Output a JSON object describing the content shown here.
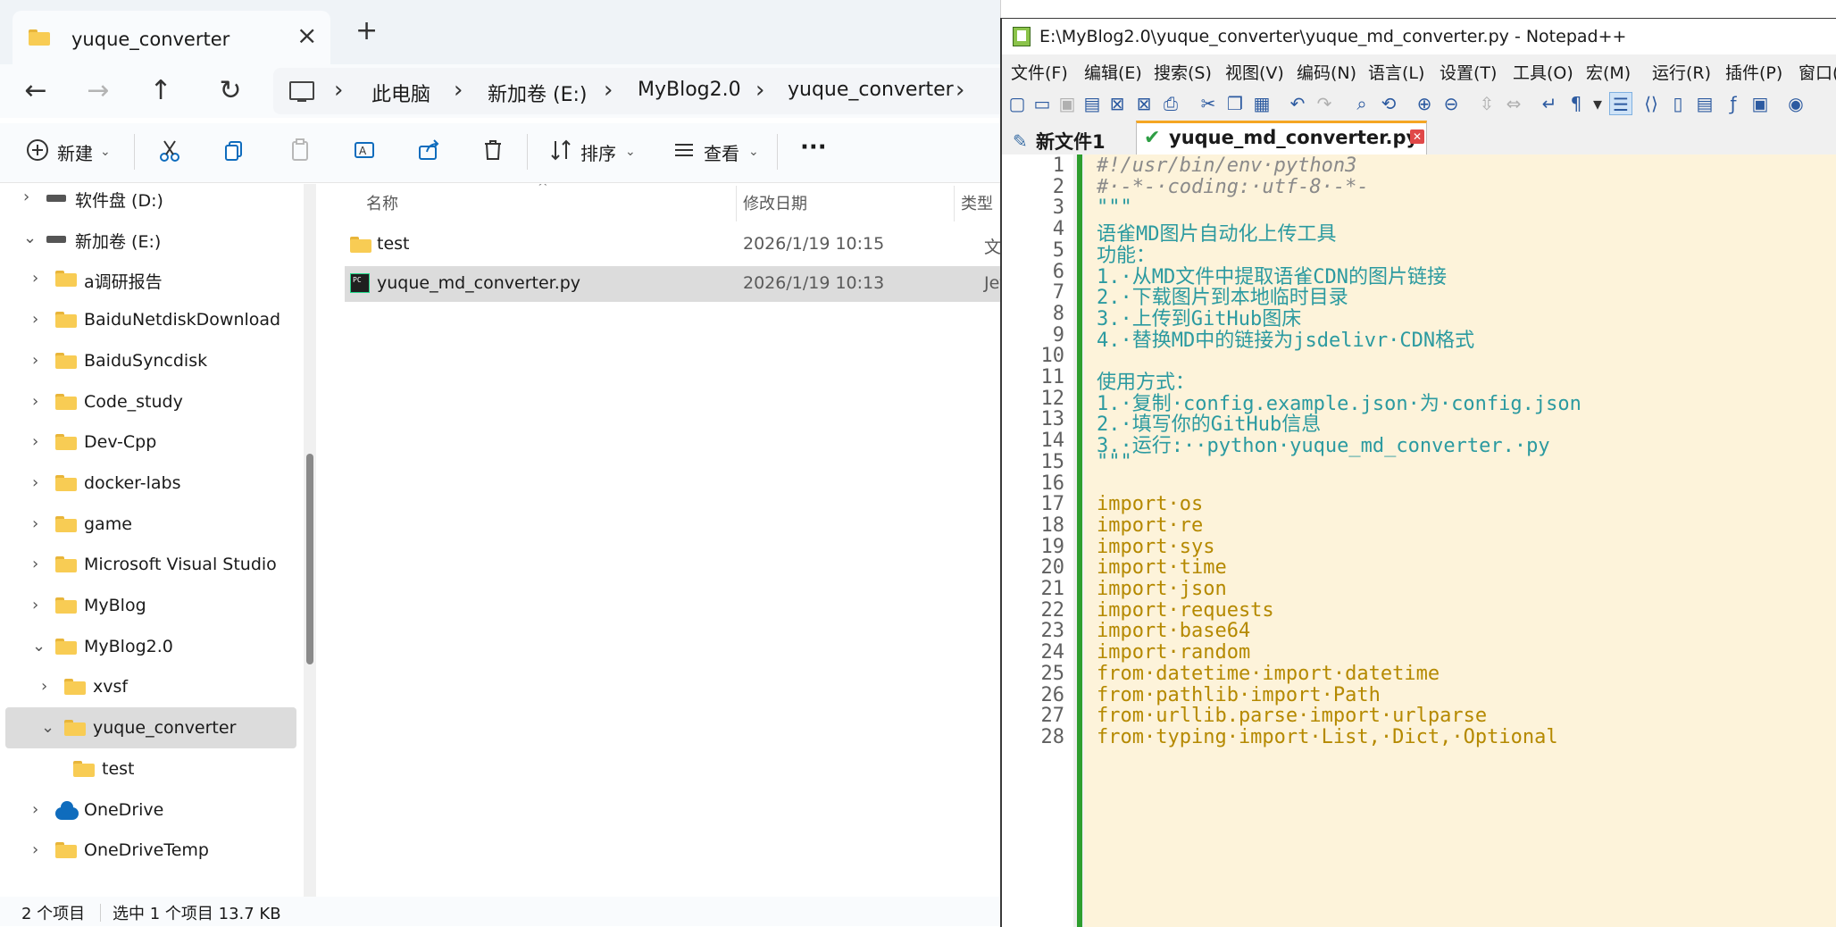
{
  "explorer": {
    "tab_title": "yuque_converter",
    "breadcrumbs": [
      "此电脑",
      "新加卷 (E:)",
      "MyBlog2.0",
      "yuque_converter"
    ],
    "toolbar": {
      "new_label": "新建",
      "sort_label": "排序",
      "view_label": "查看",
      "more_label": "···"
    },
    "tree": [
      {
        "label": "软件盘 (D:)",
        "type": "drive",
        "expanded": false,
        "indent": 0
      },
      {
        "label": "新加卷 (E:)",
        "type": "drive",
        "expanded": true,
        "indent": 0
      },
      {
        "label": "a调研报告",
        "type": "folder",
        "expanded": false,
        "indent": 1
      },
      {
        "label": "BaiduNetdiskDownload",
        "type": "folder",
        "expanded": false,
        "indent": 1
      },
      {
        "label": "BaiduSyncdisk",
        "type": "folder",
        "expanded": false,
        "indent": 1
      },
      {
        "label": "Code_study",
        "type": "folder",
        "expanded": false,
        "indent": 1
      },
      {
        "label": "Dev-Cpp",
        "type": "folder",
        "expanded": false,
        "indent": 1
      },
      {
        "label": "docker-labs",
        "type": "folder",
        "expanded": false,
        "indent": 1
      },
      {
        "label": "game",
        "type": "folder",
        "expanded": false,
        "indent": 1
      },
      {
        "label": "Microsoft Visual Studio",
        "type": "folder",
        "expanded": false,
        "indent": 1
      },
      {
        "label": "MyBlog",
        "type": "folder",
        "expanded": false,
        "indent": 1
      },
      {
        "label": "MyBlog2.0",
        "type": "folder",
        "expanded": true,
        "indent": 1
      },
      {
        "label": "xvsf",
        "type": "folder",
        "expanded": false,
        "indent": 2
      },
      {
        "label": "yuque_converter",
        "type": "folder",
        "expanded": true,
        "indent": 2,
        "selected": true
      },
      {
        "label": "test",
        "type": "folder",
        "expanded": null,
        "indent": 3
      },
      {
        "label": "OneDrive",
        "type": "cloud",
        "expanded": false,
        "indent": 1
      },
      {
        "label": "OneDriveTemp",
        "type": "folder",
        "expanded": false,
        "indent": 1
      }
    ],
    "columns": {
      "name": "名称",
      "modified": "修改日期",
      "type": "类型"
    },
    "files": [
      {
        "name": "test",
        "modified": "2026/1/19 10:15",
        "type": "文件夹",
        "icon": "folder",
        "selected": false
      },
      {
        "name": "yuque_md_converter.py",
        "modified": "2026/1/19 10:13",
        "type": "JetBrains",
        "icon": "pycharm",
        "selected": true
      }
    ],
    "status": {
      "count": "2 个项目",
      "selection": "选中 1 个项目  13.7 KB"
    }
  },
  "npp": {
    "title": "E:\\MyBlog2.0\\yuque_converter\\yuque_md_converter.py - Notepad++",
    "menu": [
      "文件(F)",
      "编辑(E)",
      "搜索(S)",
      "视图(V)",
      "编码(N)",
      "语言(L)",
      "设置(T)",
      "工具(O)",
      "宏(M)",
      "运行(R)",
      "插件(P)",
      "窗口("
    ],
    "tabs": [
      {
        "label": "新文件1",
        "active": false
      },
      {
        "label": "yuque_md_converter.py",
        "active": true
      }
    ],
    "lines": [
      {
        "n": "1",
        "text": "#!/usr/bin/env·python3",
        "kind": "com"
      },
      {
        "n": "2",
        "text": "#·-*-·coding:·utf-8·-*-",
        "kind": "com"
      },
      {
        "n": "3",
        "text": "\"\"\"",
        "kind": "doc"
      },
      {
        "n": "4",
        "text": "语雀MD图片自动化上传工具",
        "kind": "doc"
      },
      {
        "n": "5",
        "text": "功能：",
        "kind": "doc"
      },
      {
        "n": "6",
        "text": "1.·从MD文件中提取语雀CDN的图片链接",
        "kind": "doc"
      },
      {
        "n": "7",
        "text": "2.·下载图片到本地临时目录",
        "kind": "doc"
      },
      {
        "n": "8",
        "text": "3.·上传到GitHub图床",
        "kind": "doc"
      },
      {
        "n": "9",
        "text": "4.·替换MD中的链接为jsdelivr·CDN格式",
        "kind": "doc"
      },
      {
        "n": "10",
        "text": "",
        "kind": "doc"
      },
      {
        "n": "11",
        "text": "使用方式：",
        "kind": "doc"
      },
      {
        "n": "12",
        "text": "1.·复制·config.example.json·为·config.json",
        "kind": "doc"
      },
      {
        "n": "13",
        "text": "2.·填写你的GitHub信息",
        "kind": "doc"
      },
      {
        "n": "14",
        "text": "3.·运行:··python·yuque_md_converter.·py",
        "kind": "doc"
      },
      {
        "n": "15",
        "text": "\"\"\"",
        "kind": "doc"
      },
      {
        "n": "16",
        "text": "",
        "kind": "doc"
      },
      {
        "n": "17",
        "text": "import·os",
        "kind": "kw"
      },
      {
        "n": "18",
        "text": "import·re",
        "kind": "kw"
      },
      {
        "n": "19",
        "text": "import·sys",
        "kind": "kw"
      },
      {
        "n": "20",
        "text": "import·time",
        "kind": "kw"
      },
      {
        "n": "21",
        "text": "import·json",
        "kind": "kw"
      },
      {
        "n": "22",
        "text": "import·requests",
        "kind": "kw"
      },
      {
        "n": "23",
        "text": "import·base64",
        "kind": "kw"
      },
      {
        "n": "24",
        "text": "import·random",
        "kind": "kw"
      },
      {
        "n": "25",
        "text": "from·datetime·import·datetime",
        "kind": "kw"
      },
      {
        "n": "26",
        "text": "from·pathlib·import·Path",
        "kind": "kw"
      },
      {
        "n": "27",
        "text": "from·urllib.parse·import·urlparse",
        "kind": "kw"
      },
      {
        "n": "28",
        "text": "from·typing·import·List,·Dict,·Optional",
        "kind": "kw"
      }
    ]
  }
}
